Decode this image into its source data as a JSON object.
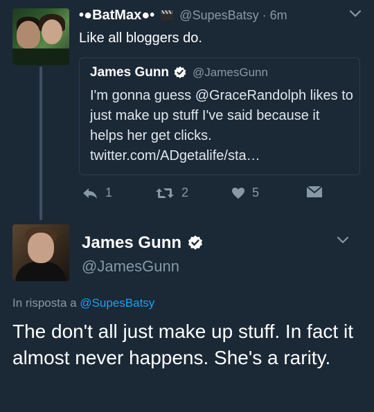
{
  "tweet1": {
    "display_name": "•●BatMax●•",
    "name_emoji": "clapperboard-icon",
    "handle": "@SupesBatsy",
    "time": "· 6m",
    "text": "Like all bloggers do.",
    "quote": {
      "display_name": "James Gunn",
      "verified": true,
      "handle": "@JamesGunn",
      "text": "I'm gonna guess @GraceRandolph likes to just make up stuff I've said because it helps her get clicks. twitter.com/ADgetalife/sta…"
    },
    "actions": {
      "reply_count": "1",
      "retweet_count": "2",
      "like_count": "5"
    }
  },
  "tweet2": {
    "display_name": "James Gunn",
    "verified": true,
    "handle": "@JamesGunn",
    "reply_prefix": "In risposta a ",
    "reply_handle": "@SupesBatsy",
    "text": "The don't all just make up stuff. In fact it almost never happens. She's a rarity."
  },
  "colors": {
    "background": "#1b2836",
    "secondary_text": "#8899a6",
    "link": "#1da1f2",
    "verified_badge": "#ffffff"
  }
}
